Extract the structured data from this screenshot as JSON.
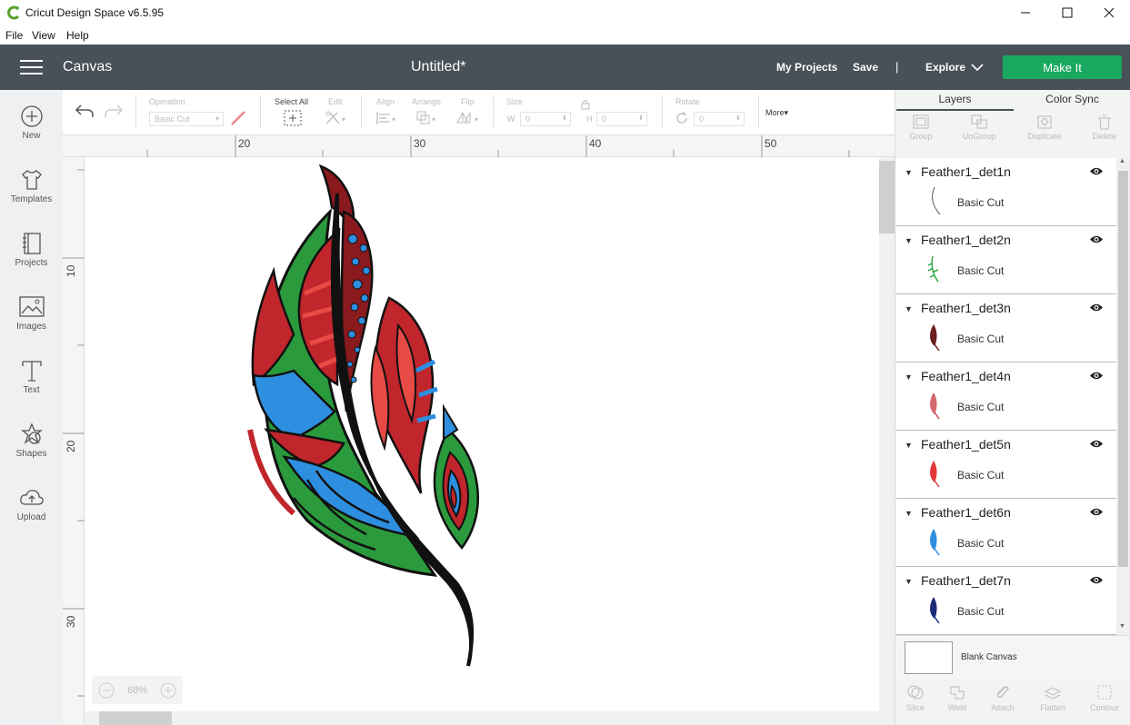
{
  "window": {
    "title": "Cricut Design Space  v6.5.95"
  },
  "menu": [
    "File",
    "View",
    "Help"
  ],
  "header": {
    "section": "Canvas",
    "document_title": "Untitled*",
    "my_projects": "My Projects",
    "save": "Save",
    "separator": "|",
    "explore": "Explore",
    "make_it": "Make It",
    "make_it_color": "#1aa860",
    "header_color": "#485058"
  },
  "sidebar": [
    {
      "label": "New",
      "icon": "plus-circle-icon"
    },
    {
      "label": "Templates",
      "icon": "tshirt-icon"
    },
    {
      "label": "Projects",
      "icon": "book-icon"
    },
    {
      "label": "Images",
      "icon": "image-icon"
    },
    {
      "label": "Text",
      "icon": "text-t-icon"
    },
    {
      "label": "Shapes",
      "icon": "shapes-icon"
    },
    {
      "label": "Upload",
      "icon": "cloud-upload-icon"
    }
  ],
  "toolbar": {
    "operation_label": "Operation",
    "operation_value": "Basic Cut",
    "select_all": "Select All",
    "edit": "Edit",
    "align": "Align",
    "arrange": "Arrange",
    "flip": "Flip",
    "size": "Size",
    "w_label": "W",
    "w_value": "0",
    "h_label": "H",
    "h_value": "0",
    "rotate": "Rotate",
    "rotate_value": "0",
    "more": "More"
  },
  "ruler": {
    "horizontal": [
      "20",
      "30",
      "40",
      "50"
    ],
    "vertical": [
      "10",
      "20",
      "30"
    ]
  },
  "zoom": {
    "minus": "−",
    "value": "68%",
    "plus": "+"
  },
  "panel": {
    "tabs": [
      "Layers",
      "Color Sync"
    ],
    "tools": [
      "Group",
      "UnGroup",
      "Duplicate",
      "Delete"
    ],
    "layers": [
      {
        "name": "Feather1_det1n",
        "operation": "Basic Cut",
        "color": "#555555"
      },
      {
        "name": "Feather1_det2n",
        "operation": "Basic Cut",
        "color": "#3aa84a"
      },
      {
        "name": "Feather1_det3n",
        "operation": "Basic Cut",
        "color": "#6a1e1e"
      },
      {
        "name": "Feather1_det4n",
        "operation": "Basic Cut",
        "color": "#c0454a"
      },
      {
        "name": "Feather1_det5n",
        "operation": "Basic Cut",
        "color": "#e23a3a"
      },
      {
        "name": "Feather1_det6n",
        "operation": "Basic Cut",
        "color": "#2e8fe0"
      },
      {
        "name": "Feather1_det7n",
        "operation": "Basic Cut",
        "color": "#1c2a7a"
      }
    ],
    "blank_canvas": "Blank Canvas",
    "bottom_tools": [
      "Slice",
      "Weld",
      "Attach",
      "Flatten",
      "Contour"
    ]
  }
}
